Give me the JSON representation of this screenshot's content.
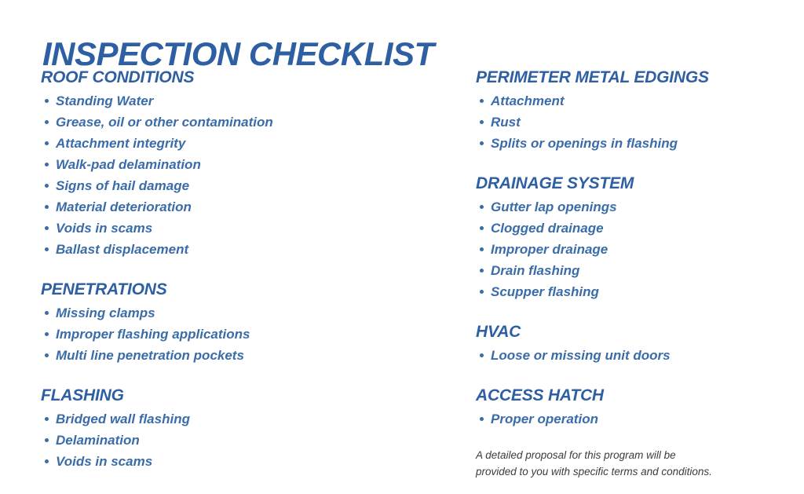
{
  "document": {
    "title": "INSPECTION CHECKLIST",
    "accent_color": "#2E5FA3",
    "body_color": "#3A6CA9",
    "footnote_color": "#3C3C3C",
    "background_color": "#FFFFFF"
  },
  "columns": {
    "left": [
      {
        "heading": "ROOF CONDITIONS",
        "items": [
          "Standing Water",
          "Grease, oil or other contamination",
          "Attachment integrity",
          "Walk-pad delamination",
          "Signs of hail damage",
          "Material deterioration",
          "Voids in scams",
          "Ballast displacement"
        ]
      },
      {
        "heading": "PENETRATIONS",
        "items": [
          "Missing clamps",
          "Improper flashing applications",
          "Multi line penetration pockets"
        ]
      },
      {
        "heading": "FLASHING",
        "items": [
          "Bridged wall flashing",
          "Delamination",
          "Voids in scams"
        ]
      }
    ],
    "right": [
      {
        "heading": "PERIMETER METAL EDGINGS",
        "items": [
          "Attachment",
          "Rust",
          "Splits or openings in flashing"
        ]
      },
      {
        "heading": "DRAINAGE SYSTEM",
        "items": [
          "Gutter lap openings",
          "Clogged drainage",
          "Improper drainage",
          "Drain flashing",
          "Scupper flashing"
        ]
      },
      {
        "heading": "HVAC",
        "items": [
          "Loose or missing unit doors"
        ]
      },
      {
        "heading": "ACCESS HATCH",
        "items": [
          "Proper operation"
        ]
      }
    ]
  },
  "footnote": {
    "line1": "A detailed proposal for this program will be",
    "line2": "provided to you with specific terms and conditions."
  }
}
